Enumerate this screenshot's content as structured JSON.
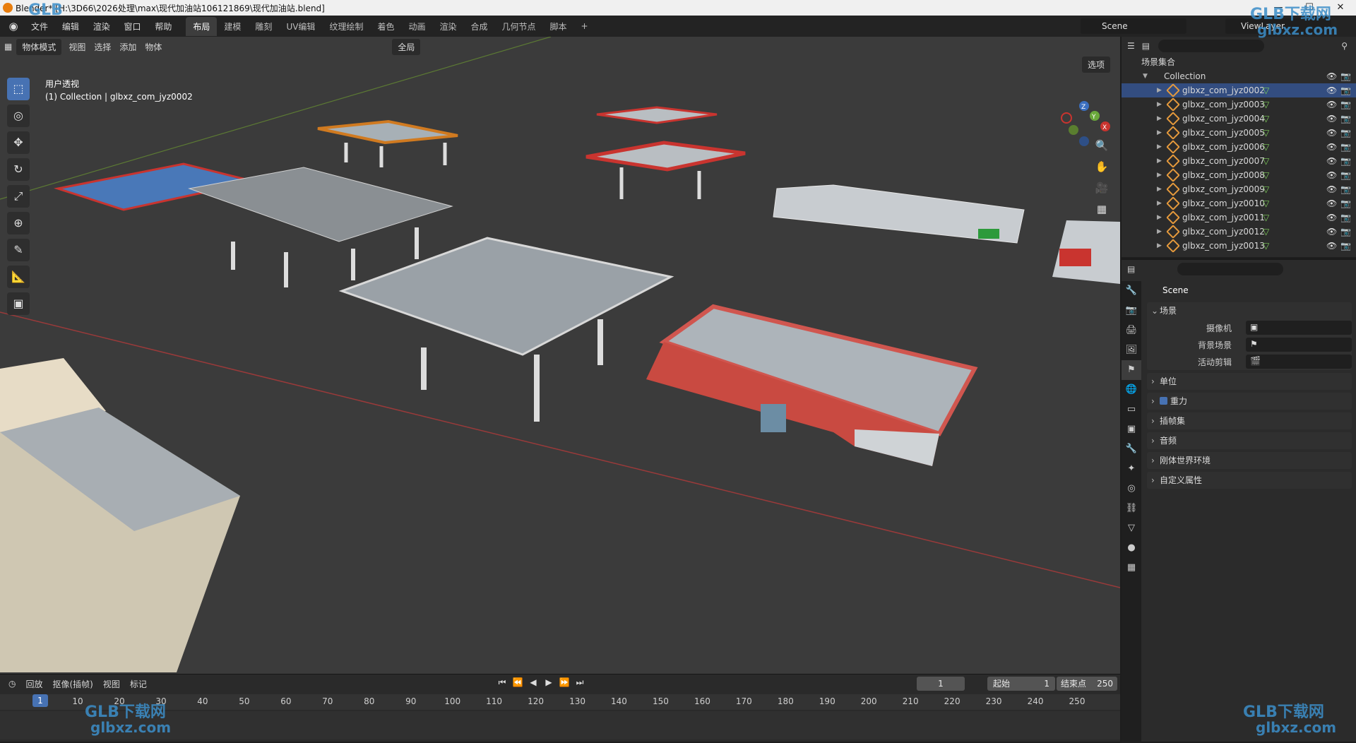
{
  "window": {
    "title": "Blender* [H:\\3D66\\2026处理\\max\\现代加油站106121869\\现代加油站.blend]",
    "controls": [
      "—",
      "☐",
      "✕"
    ]
  },
  "menu": [
    "文件",
    "编辑",
    "渲染",
    "窗口",
    "帮助"
  ],
  "workspaces": [
    {
      "label": "布局",
      "active": true
    },
    {
      "label": "建模"
    },
    {
      "label": "雕刻"
    },
    {
      "label": "UV编辑"
    },
    {
      "label": "纹理绘制"
    },
    {
      "label": "着色"
    },
    {
      "label": "动画"
    },
    {
      "label": "渲染"
    },
    {
      "label": "合成"
    },
    {
      "label": "几何节点"
    },
    {
      "label": "脚本"
    },
    {
      "label": "+"
    }
  ],
  "scene_name": "Scene",
  "view_layer": "ViewLayer",
  "viewport": {
    "mode": "物体模式",
    "menus": [
      "视图",
      "选择",
      "添加",
      "物体"
    ],
    "transform": "全局",
    "options": "选项",
    "info_line1": "用户透视",
    "info_line2": "(1) Collection | glbxz_com_jyz0002",
    "tools": [
      {
        "icon": "cursor-select-icon",
        "glyph": "⬚",
        "active": true
      },
      {
        "icon": "cursor-3d-icon",
        "glyph": "◎"
      },
      {
        "icon": "move-icon",
        "glyph": "✥"
      },
      {
        "icon": "rotate-icon",
        "glyph": "↻"
      },
      {
        "icon": "scale-icon",
        "glyph": "⤢"
      },
      {
        "icon": "transform-icon",
        "glyph": "⊕"
      },
      {
        "icon": "annotate-icon",
        "glyph": "✎"
      },
      {
        "icon": "measure-icon",
        "glyph": "📐"
      },
      {
        "icon": "add-cube-icon",
        "glyph": "▣"
      }
    ],
    "nav": [
      "🔍",
      "✋",
      "🎥",
      "▦"
    ],
    "gizmo": {
      "x": "X",
      "y": "Y",
      "z": "Z"
    }
  },
  "timeline": {
    "menus": [
      "回放",
      "抠像(插帧)",
      "视图",
      "标记"
    ],
    "current_frame": "1",
    "start_label": "起始",
    "start": "1",
    "end_label": "结束点",
    "end": "250",
    "ruler": [
      "1",
      "10",
      "20",
      "30",
      "40",
      "50",
      "60",
      "70",
      "80",
      "90",
      "100",
      "110",
      "120",
      "130",
      "140",
      "150",
      "160",
      "170",
      "180",
      "190",
      "200",
      "210",
      "220",
      "230",
      "240",
      "250"
    ],
    "play_icons": [
      "⏮",
      "⏪",
      "◀",
      "▶",
      "⏩",
      "⏭"
    ]
  },
  "outliner": {
    "root": "场景集合",
    "collection": "Collection",
    "items": [
      "glbxz_com_jyz0002",
      "glbxz_com_jyz0003",
      "glbxz_com_jyz0004",
      "glbxz_com_jyz0005",
      "glbxz_com_jyz0006",
      "glbxz_com_jyz0007",
      "glbxz_com_jyz0008",
      "glbxz_com_jyz0009",
      "glbxz_com_jyz0010",
      "glbxz_com_jyz0011",
      "glbxz_com_jyz0012",
      "glbxz_com_jyz0013"
    ],
    "selected": "glbxz_com_jyz0002"
  },
  "properties": {
    "title": "Scene",
    "scene_panel": "场景",
    "camera_label": "摄像机",
    "bg_label": "背景场景",
    "clip_label": "活动剪辑",
    "panels": [
      "单位",
      "重力",
      "插帧集",
      "音频",
      "刚体世界环境",
      "自定义属性"
    ]
  },
  "watermarks": {
    "brand": "GLB下载网",
    "url": "glbxz.com",
    "logo": "GLB"
  },
  "colors": {
    "accent": "#4772b3",
    "selected_row": "#334d80",
    "viewport_bg": "#3b3b3b"
  }
}
